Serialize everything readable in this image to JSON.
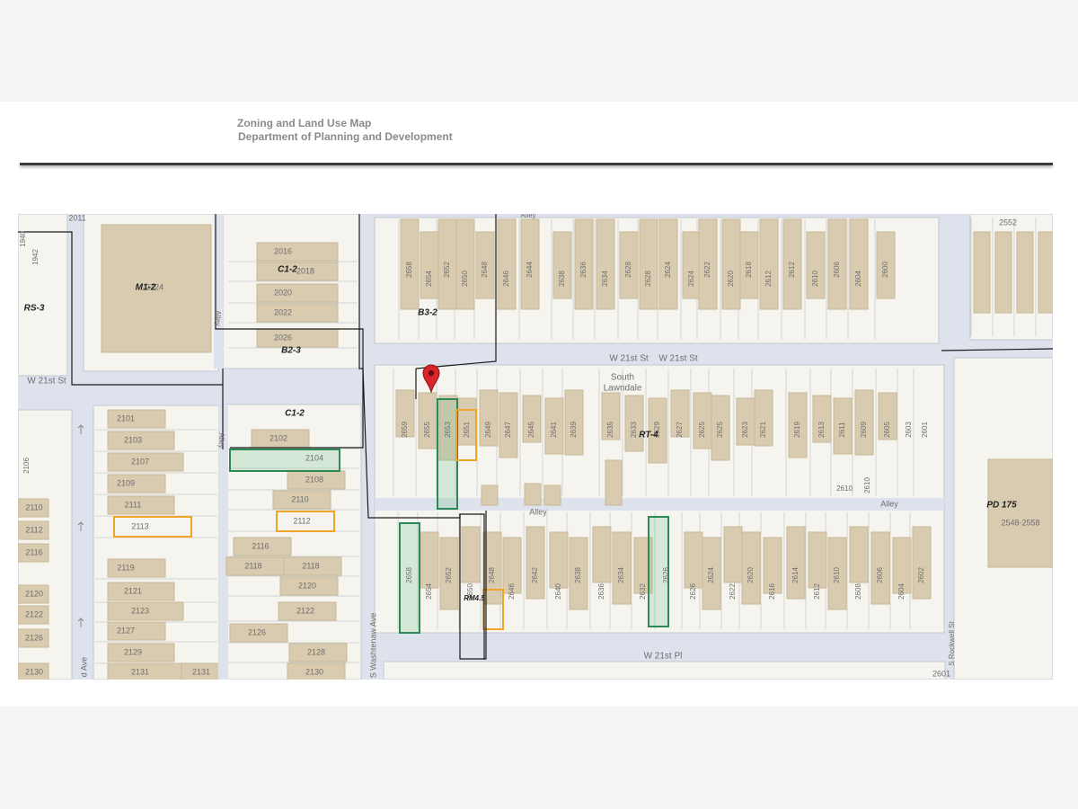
{
  "header": {
    "title": "Zoning and Land Use Map",
    "subtitle": "Department of Planning and Development"
  },
  "colors": {
    "street": "#dde2ec",
    "street_edge": "#c3c9d3",
    "block": "#f5f4ef",
    "building": "#d9cbb0",
    "building_edge": "#c8b896",
    "lot_line": "#cfcfcf",
    "zoning_boundary": "#1a1a1a",
    "highlight_green": "#2e8a55",
    "highlight_orange": "#f0a526",
    "marker": "#d9252c"
  },
  "map": {
    "marker": "location-pin",
    "community_area": [
      "South",
      "Lawndale"
    ],
    "streets": {
      "w21st_st": "W 21st St",
      "w21st_st_dup": "W 21st St",
      "w21st_st_west": "W 21st St",
      "w21st_pl": "W 21st Pl",
      "washtenaw": "S Washtenaw Ave",
      "rockwell": "S Rockwell St",
      "western_ave": "d Ave",
      "alley_top": "Alley",
      "alley_mid": "Alley",
      "alley_right": "Alley",
      "alley_west": "Alley",
      "alley_west2": "Alley"
    },
    "zoning": {
      "rs3": "RS-3",
      "m12": "M1-2",
      "c12_top": "C1-2",
      "b32": "B3-2",
      "b23": "B2-3",
      "c12_mid": "C1-2",
      "rt4": "RT-4",
      "pd175": "PD 175",
      "rm45": "RM4.5"
    },
    "addresses": {
      "far_left": [
        "1940",
        "1942",
        "2106",
        "2110",
        "2112",
        "2116",
        "2120",
        "2122",
        "2126",
        "2130"
      ],
      "top_strip": [
        "2011"
      ],
      "m12_parcel": "2724",
      "col_a": [
        "2101",
        "2103",
        "2107",
        "2109",
        "2111",
        "2113",
        "2119",
        "2121",
        "2123",
        "2127",
        "2129",
        "2131",
        "2131"
      ],
      "col_b_top": [
        "2016",
        "2018",
        "2020",
        "2022",
        "2026"
      ],
      "col_b": [
        "2102",
        "2104",
        "2108",
        "2110",
        "2112",
        "2116",
        "2118",
        "2118",
        "2120",
        "2122",
        "2126",
        "2128",
        "2130"
      ],
      "north_block": [
        "2658",
        "2654",
        "2652",
        "2650",
        "2648",
        "2646",
        "2644",
        "2638",
        "2636",
        "2634",
        "2628",
        "2628",
        "2624",
        "2624",
        "2622",
        "2620",
        "2618",
        "2612",
        "2612",
        "2610",
        "2606",
        "2604",
        "2600"
      ],
      "middle_north_row": [
        "2659",
        "2655",
        "2653",
        "2651",
        "2649",
        "2647",
        "2645",
        "2641",
        "2639",
        "2635",
        "2633",
        "2629",
        "2627",
        "2625",
        "2625",
        "2623",
        "2621",
        "2619",
        "2613",
        "2611",
        "2609",
        "2605",
        "2603",
        "2601",
        "2610",
        "2610"
      ],
      "south_block": [
        "2658",
        "2654",
        "2652",
        "2650",
        "2648",
        "2646",
        "2642",
        "2640",
        "2638",
        "2636",
        "2634",
        "2632",
        "2626",
        "2626",
        "2624",
        "2622",
        "2620",
        "2616",
        "2614",
        "2612",
        "2610",
        "2608",
        "2606",
        "2604",
        "2602"
      ],
      "pd175_parcel": "2548-2558",
      "top_right": "2552",
      "bottom_right": "2601"
    }
  }
}
